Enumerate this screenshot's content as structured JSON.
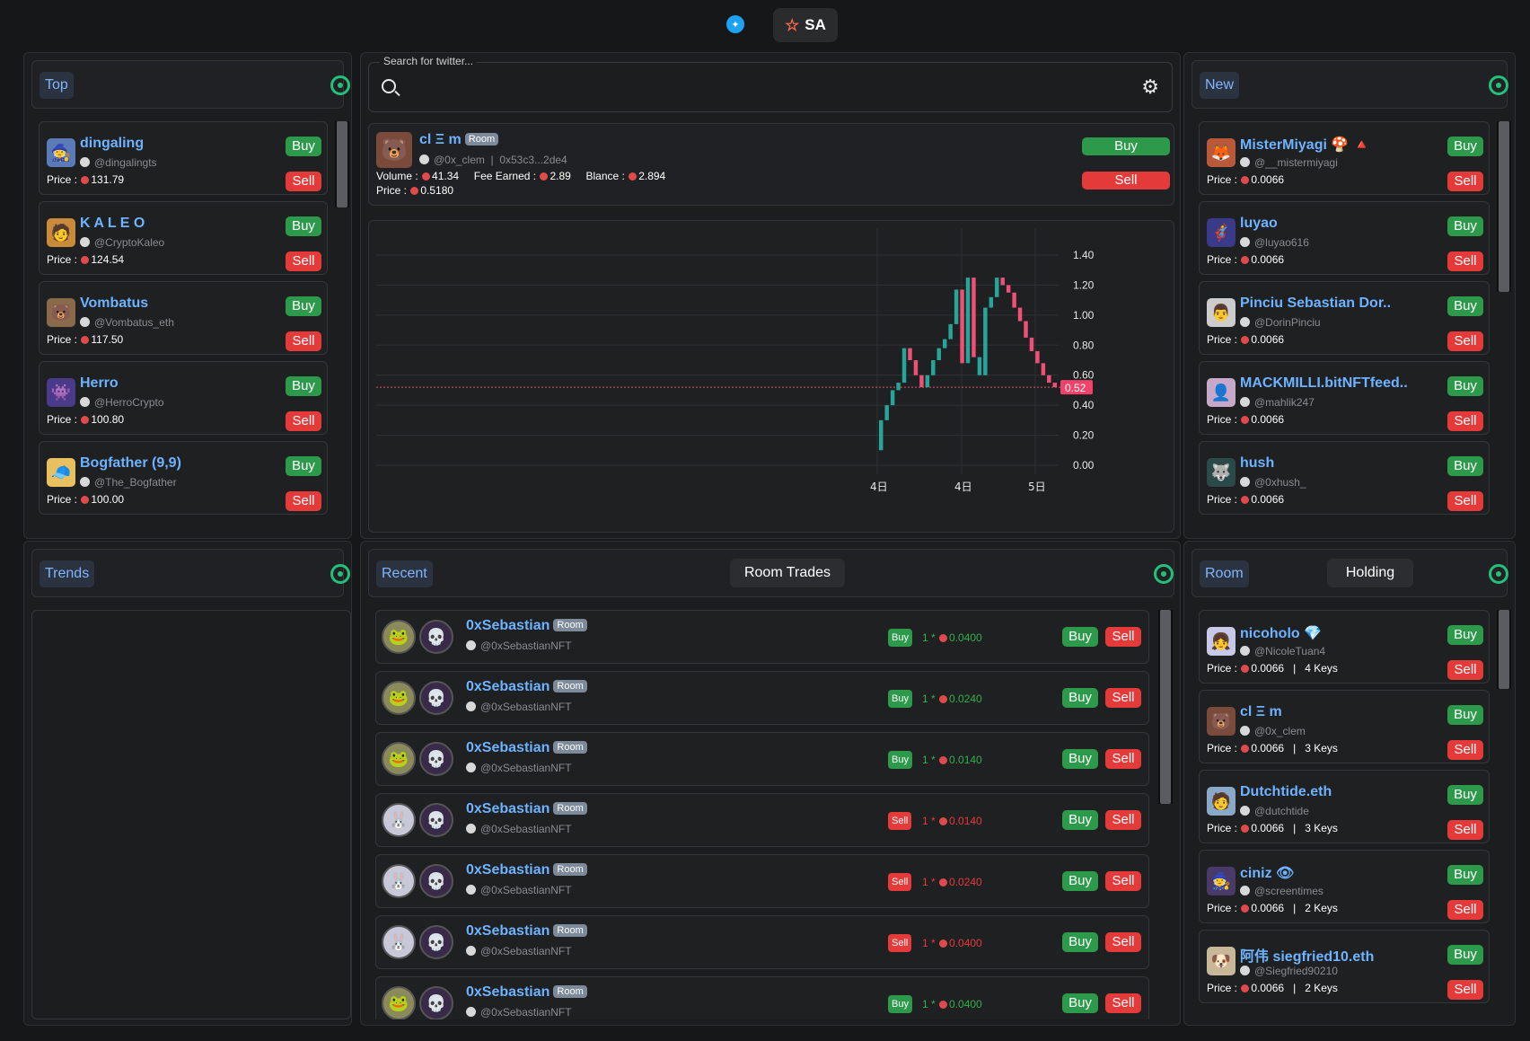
{
  "topbar": {
    "bird_icon": "twitter-bird-icon",
    "sa_label": "SA"
  },
  "top_panel": {
    "tab": "Top",
    "items": [
      {
        "name": "dingaling",
        "handle": "@dingalingts",
        "price": "131.79",
        "avatar": "🧙",
        "avbg": "#5b7bb8"
      },
      {
        "name": "K A L E O",
        "handle": "@CryptoKaleo",
        "price": "124.54",
        "avatar": "🧑",
        "avbg": "#c98a3a"
      },
      {
        "name": "Vombatus",
        "handle": "@Vombatus_eth",
        "price": "117.50",
        "avatar": "🐻",
        "avbg": "#8a6a4a"
      },
      {
        "name": "Herro",
        "handle": "@HerroCrypto",
        "price": "100.80",
        "avatar": "👾",
        "avbg": "#4a3a8a"
      },
      {
        "name": "Bogfather (9,9)",
        "handle": "@The_Bogfather",
        "price": "100.00",
        "avatar": "🧢",
        "avbg": "#e8c060"
      }
    ]
  },
  "labels": {
    "buy": "Buy",
    "sell": "Sell",
    "price": "Price :",
    "room": "Room"
  },
  "trends_panel": {
    "tab": "Trends"
  },
  "search": {
    "placeholder": "Search for twitter..."
  },
  "profile": {
    "name": "cl Ξ m",
    "room_badge": "Room",
    "handle": "@0x_clem",
    "address": "0x53c3...2de4",
    "volume_label": "Volume :",
    "volume": "41.34",
    "fee_label": "Fee Earned :",
    "fee": "2.89",
    "balance_label": "Blance :",
    "balance": "2.894",
    "price_label": "Price :",
    "price": "0.5180",
    "buy": "Buy",
    "sell": "Sell"
  },
  "chart_data": {
    "type": "candlestick",
    "y_ticks": [
      "1.40",
      "1.20",
      "1.00",
      "0.80",
      "0.60",
      "0.40",
      "0.20",
      "0.00"
    ],
    "ylim": [
      0,
      1.4
    ],
    "x_ticks": [
      "4日",
      "4日",
      "5日"
    ],
    "current_price_label": "0.52",
    "current_price": 0.52,
    "candles": [
      [
        0.1,
        0.3,
        "up"
      ],
      [
        0.3,
        0.4,
        "up"
      ],
      [
        0.4,
        0.5,
        "up"
      ],
      [
        0.5,
        0.55,
        "up"
      ],
      [
        0.55,
        0.78,
        "up"
      ],
      [
        0.78,
        0.7,
        "down"
      ],
      [
        0.7,
        0.6,
        "down"
      ],
      [
        0.6,
        0.52,
        "down"
      ],
      [
        0.52,
        0.6,
        "up"
      ],
      [
        0.6,
        0.7,
        "up"
      ],
      [
        0.7,
        0.78,
        "up"
      ],
      [
        0.78,
        0.84,
        "up"
      ],
      [
        0.84,
        0.94,
        "up"
      ],
      [
        0.94,
        1.17,
        "up"
      ],
      [
        1.17,
        0.68,
        "down"
      ],
      [
        0.68,
        1.25,
        "up"
      ],
      [
        1.25,
        0.72,
        "down"
      ],
      [
        0.72,
        0.6,
        "up"
      ],
      [
        0.6,
        1.05,
        "up"
      ],
      [
        1.05,
        1.12,
        "up"
      ],
      [
        1.12,
        1.25,
        "up"
      ],
      [
        1.25,
        1.2,
        "down"
      ],
      [
        1.2,
        1.15,
        "down"
      ],
      [
        1.15,
        1.05,
        "down"
      ],
      [
        1.05,
        0.96,
        "down"
      ],
      [
        0.96,
        0.85,
        "down"
      ],
      [
        0.85,
        0.76,
        "down"
      ],
      [
        0.76,
        0.68,
        "down"
      ],
      [
        0.68,
        0.6,
        "down"
      ],
      [
        0.6,
        0.55,
        "down"
      ],
      [
        0.55,
        0.52,
        "down"
      ]
    ]
  },
  "new_panel": {
    "tab": "New",
    "items": [
      {
        "name": "MisterMiyagi 🍄 🔺",
        "handle": "@__mistermiyagi",
        "price": "0.0066",
        "avatar": "🦊",
        "avbg": "#b85a3a"
      },
      {
        "name": "luyao",
        "handle": "@luyao616",
        "price": "0.0066",
        "avatar": "🦸",
        "avbg": "#3a3a8a"
      },
      {
        "name": "Pinciu Sebastian Dor..",
        "handle": "@DorinPinciu",
        "price": "0.0066",
        "avatar": "👨",
        "avbg": "#cccccc"
      },
      {
        "name": "MACKMILLI.bitNFTfeed..",
        "handle": "@mahlik247",
        "price": "0.0066",
        "avatar": "👤",
        "avbg": "#c8a8c8"
      },
      {
        "name": "hush",
        "handle": "@0xhush_",
        "price": "0.0066",
        "avatar": "🐺",
        "avbg": "#2a4a4a"
      }
    ]
  },
  "recent_panel": {
    "tab": "Recent",
    "room_trades": "Room Trades",
    "trades": [
      {
        "name": "0xSebastian",
        "handle": "@0xSebastianNFT",
        "type": "Buy",
        "qty": "1",
        "amount": "0.0400"
      },
      {
        "name": "0xSebastian",
        "handle": "@0xSebastianNFT",
        "type": "Buy",
        "qty": "1",
        "amount": "0.0240"
      },
      {
        "name": "0xSebastian",
        "handle": "@0xSebastianNFT",
        "type": "Buy",
        "qty": "1",
        "amount": "0.0140"
      },
      {
        "name": "0xSebastian",
        "handle": "@0xSebastianNFT",
        "type": "Sell",
        "qty": "1",
        "amount": "0.0140"
      },
      {
        "name": "0xSebastian",
        "handle": "@0xSebastianNFT",
        "type": "Sell",
        "qty": "1",
        "amount": "0.0240"
      },
      {
        "name": "0xSebastian",
        "handle": "@0xSebastianNFT",
        "type": "Sell",
        "qty": "1",
        "amount": "0.0400"
      },
      {
        "name": "0xSebastian",
        "handle": "@0xSebastianNFT",
        "type": "Buy",
        "qty": "1",
        "amount": "0.0400"
      }
    ]
  },
  "room_panel": {
    "tab": "Room",
    "holding": "Holding",
    "items": [
      {
        "name": "nicoholo 💎",
        "handle": "@NicoleTuan4",
        "price": "0.0066",
        "keys": "4 Keys",
        "avatar": "👧",
        "avbg": "#c8c8e8"
      },
      {
        "name": "cl Ξ m",
        "handle": "@0x_clem",
        "price": "0.0066",
        "keys": "3 Keys",
        "avatar": "🐻",
        "avbg": "#7a4a3a"
      },
      {
        "name": "Dutchtide.eth",
        "handle": "@dutchtide",
        "price": "0.0066",
        "keys": "3 Keys",
        "avatar": "🧑",
        "avbg": "#8aa8c8"
      },
      {
        "name": "ciniz 👁",
        "handle": "@screentimes",
        "price": "0.0066",
        "keys": "2 Keys",
        "avatar": "🧙",
        "avbg": "#4a3a6a"
      },
      {
        "name": "阿伟 siegfried10.eth",
        "handle": "@Siegfried90210",
        "price": "0.0066",
        "keys": "2 Keys",
        "avatar": "🐶",
        "avbg": "#c8b898"
      }
    ]
  }
}
